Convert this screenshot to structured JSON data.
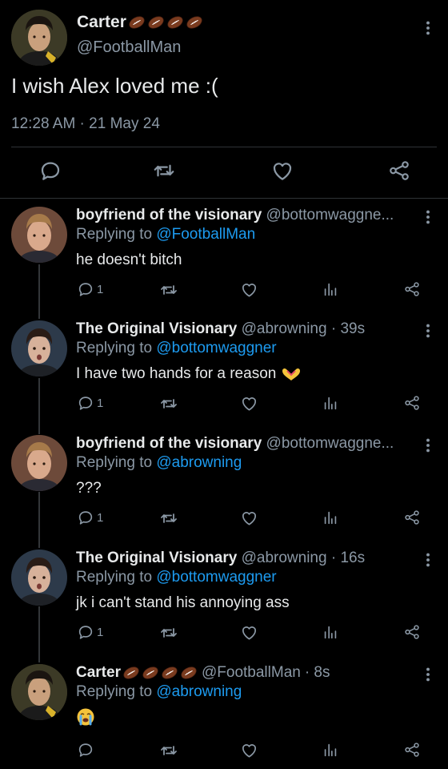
{
  "main_tweet": {
    "name": "Carter",
    "handle": "@FootballMan",
    "text": "I wish Alex loved me :(",
    "timestamp": "12:28 AM · 21 May 24",
    "badge_icons": [
      "football-emoji",
      "football-emoji",
      "football-emoji",
      "football-emoji"
    ]
  },
  "replies": [
    {
      "name": "boyfriend of the visionary",
      "handle": "@bottomwaggne...",
      "time": "",
      "replying_prefix": "Replying to",
      "replying_to": "@FootballMan",
      "text": "he doesn't bitch",
      "reply_count": "1",
      "avatar": "man-blond"
    },
    {
      "name": "The Original Visionary",
      "handle": "@abrowning",
      "time": "· 39s",
      "replying_prefix": "Replying to",
      "replying_to": "@bottomwaggner",
      "text": "I have two hands for a reason",
      "reply_count": "1",
      "avatar": "man-dark"
    },
    {
      "name": "boyfriend of the visionary",
      "handle": "@bottomwaggne...",
      "time": "",
      "replying_prefix": "Replying to",
      "replying_to": "@abrowning",
      "text": "???",
      "reply_count": "1",
      "avatar": "man-blond"
    },
    {
      "name": "The Original Visionary",
      "handle": "@abrowning",
      "time": "· 16s",
      "replying_prefix": "Replying to",
      "replying_to": "@bottomwaggner",
      "text": "jk i can't stand his annoying ass",
      "reply_count": "1",
      "avatar": "man-dark"
    },
    {
      "name": "Carter",
      "handle": "@FootballMan",
      "time": "· 8s",
      "replying_prefix": "Replying to",
      "replying_to": "@abrowning",
      "text": "",
      "reply_count": "",
      "avatar": "man-carter"
    }
  ],
  "icons": {
    "reply": "reply-icon",
    "retweet": "retweet-icon",
    "like": "heart-icon",
    "views": "analytics-icon",
    "share": "share-icon",
    "more": "more-vertical-icon",
    "hands": "heart-hands-emoji",
    "crying": "loudly-crying-emoji"
  },
  "colors": {
    "background": "#000000",
    "text": "#e7e9ea",
    "secondary": "#8b98a5",
    "mention": "#1d9bf0",
    "divider": "#2f3336"
  }
}
